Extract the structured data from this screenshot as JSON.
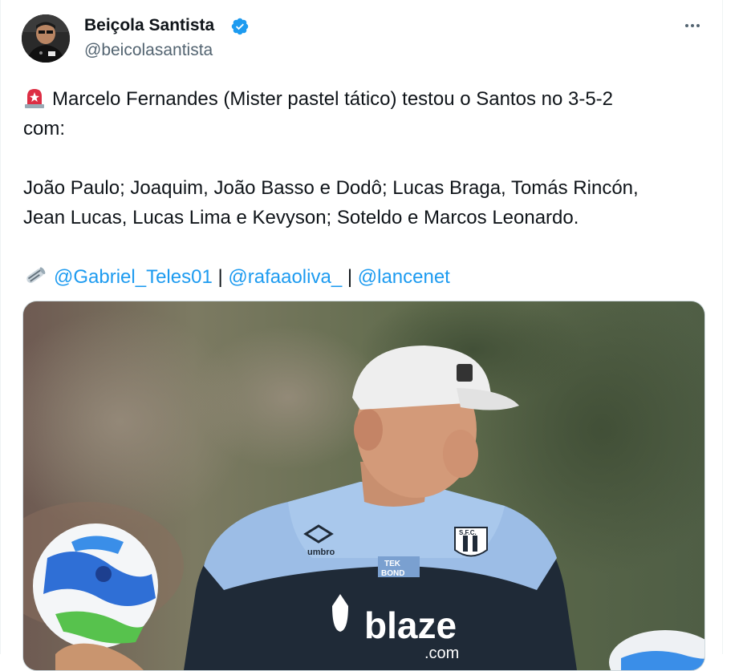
{
  "author": {
    "name": "Beiçola Santista",
    "handle": "@beicolasantista",
    "verified": true
  },
  "menu": {
    "icon": "more-horizontal-icon"
  },
  "tweet": {
    "line1": "Marcelo Fernandes (Mister pastel tático) testou o Santos no 3-5-2",
    "line2": "com:",
    "line3": "João Paulo; Joaquim, João Basso e Dodô; Lucas Braga, Tomás Rincón,",
    "line4": "Jean Lucas, Lucas Lima e Kevyson; Soteldo e Marcos Leonardo.",
    "mentions": [
      "@Gabriel_Teles01",
      "@rafaaoliva_",
      "@lancenet"
    ],
    "separator": "|",
    "emojis": [
      "siren-icon",
      "newspaper-icon"
    ]
  },
  "media": {
    "shirt_brand": "blaze",
    "shirt_brand_suffix": ".com",
    "sleeve_logo": "umbro",
    "patch_text_1": "TEK",
    "patch_text_2": "BOND",
    "crest": "S.F.C."
  },
  "colors": {
    "link": "#1d9bf0",
    "text": "#0f1419",
    "secondary": "#536471",
    "verified": "#1d9bf0"
  }
}
